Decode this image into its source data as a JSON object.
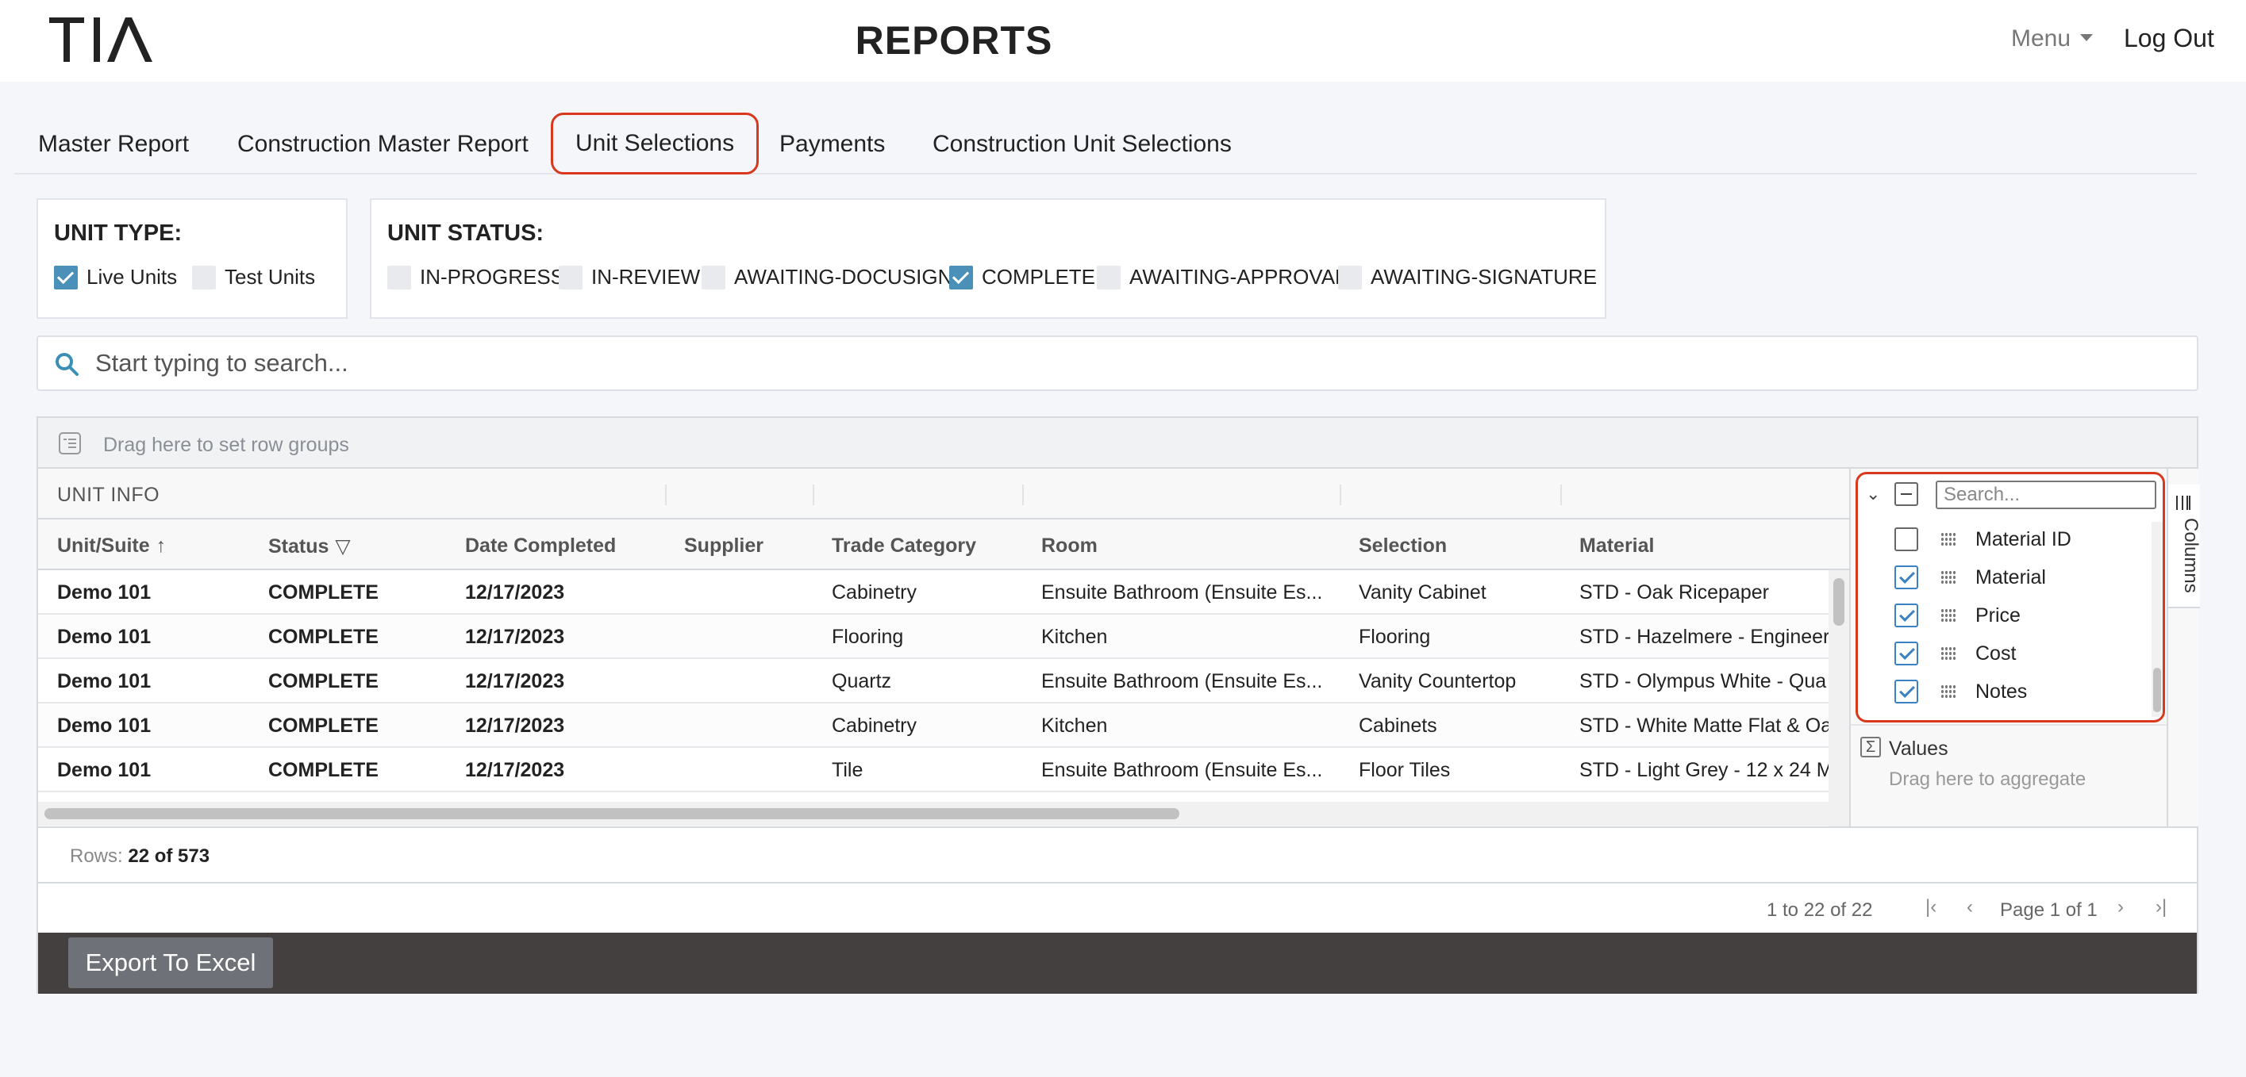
{
  "header": {
    "logo_text": "TIA",
    "title": "REPORTS",
    "menu_label": "Menu",
    "logout_label": "Log Out"
  },
  "tabs": [
    {
      "label": "Master Report",
      "active": false
    },
    {
      "label": "Construction Master Report",
      "active": false
    },
    {
      "label": "Unit Selections",
      "active": true
    },
    {
      "label": "Payments",
      "active": false
    },
    {
      "label": "Construction Unit Selections",
      "active": false
    }
  ],
  "unit_type": {
    "title": "UNIT TYPE:",
    "options": [
      {
        "label": "Live Units",
        "checked": true
      },
      {
        "label": "Test Units",
        "checked": false
      }
    ]
  },
  "unit_status": {
    "title": "UNIT STATUS:",
    "options": [
      {
        "label": "IN-PROGRESS",
        "checked": false
      },
      {
        "label": "IN-REVIEW",
        "checked": false
      },
      {
        "label": "AWAITING-DOCUSIGN",
        "checked": false
      },
      {
        "label": "COMPLETE",
        "checked": true
      },
      {
        "label": "AWAITING-APPROVAL",
        "checked": false
      },
      {
        "label": "AWAITING-SIGNATURE",
        "checked": false
      }
    ]
  },
  "search": {
    "placeholder": "Start typing to search..."
  },
  "grid": {
    "group_bar_text": "Drag here to set row groups",
    "header_group_label": "UNIT INFO",
    "columns": [
      {
        "label": "Unit/Suite",
        "icon": "sort-ascending-icon"
      },
      {
        "label": "Status",
        "icon": "filter-icon"
      },
      {
        "label": "Date Completed"
      },
      {
        "label": "Supplier"
      },
      {
        "label": "Trade Category"
      },
      {
        "label": "Room"
      },
      {
        "label": "Selection"
      },
      {
        "label": "Material"
      }
    ],
    "rows": [
      {
        "unit": "Demo 101",
        "status": "COMPLETE",
        "date": "12/17/2023",
        "supplier": "",
        "trade": "Cabinetry",
        "room": "Ensuite Bathroom (Ensuite Es...",
        "selection": "Vanity Cabinet",
        "material": "STD - Oak Ricepaper"
      },
      {
        "unit": "Demo 101",
        "status": "COMPLETE",
        "date": "12/17/2023",
        "supplier": "",
        "trade": "Flooring",
        "room": "Kitchen",
        "selection": "Flooring",
        "material": "STD - Hazelmere - Engineer"
      },
      {
        "unit": "Demo 101",
        "status": "COMPLETE",
        "date": "12/17/2023",
        "supplier": "",
        "trade": "Quartz",
        "room": "Ensuite Bathroom (Ensuite Es...",
        "selection": "Vanity Countertop",
        "material": "STD - Olympus White - Qua"
      },
      {
        "unit": "Demo 101",
        "status": "COMPLETE",
        "date": "12/17/2023",
        "supplier": "",
        "trade": "Cabinetry",
        "room": "Kitchen",
        "selection": "Cabinets",
        "material": "STD - White Matte Flat & Oa"
      },
      {
        "unit": "Demo 101",
        "status": "COMPLETE",
        "date": "12/17/2023",
        "supplier": "",
        "trade": "Tile",
        "room": "Ensuite Bathroom (Ensuite Es...",
        "selection": "Floor Tiles",
        "material": "STD - Light Grey - 12 x 24 M"
      }
    ]
  },
  "columns_panel": {
    "search_placeholder": "Search...",
    "items": [
      {
        "label": "Material ID",
        "checked": false
      },
      {
        "label": "Material",
        "checked": true
      },
      {
        "label": "Price",
        "checked": true
      },
      {
        "label": "Cost",
        "checked": true
      },
      {
        "label": "Notes",
        "checked": true
      }
    ],
    "values_label": "Values",
    "values_hint": "Drag here to aggregate",
    "side_tab_label": "Columns"
  },
  "status_bar": {
    "rows_label": "Rows:",
    "rows_value": "22 of 573"
  },
  "pagination": {
    "summary": "1 to 22 of 22",
    "page_text": "Page 1 of 1"
  },
  "footer": {
    "export_label": "Export To Excel"
  },
  "colors": {
    "accent_highlight": "#d9381e",
    "checkbox_checked": "#4a90b8",
    "footer_bg": "#444040"
  }
}
